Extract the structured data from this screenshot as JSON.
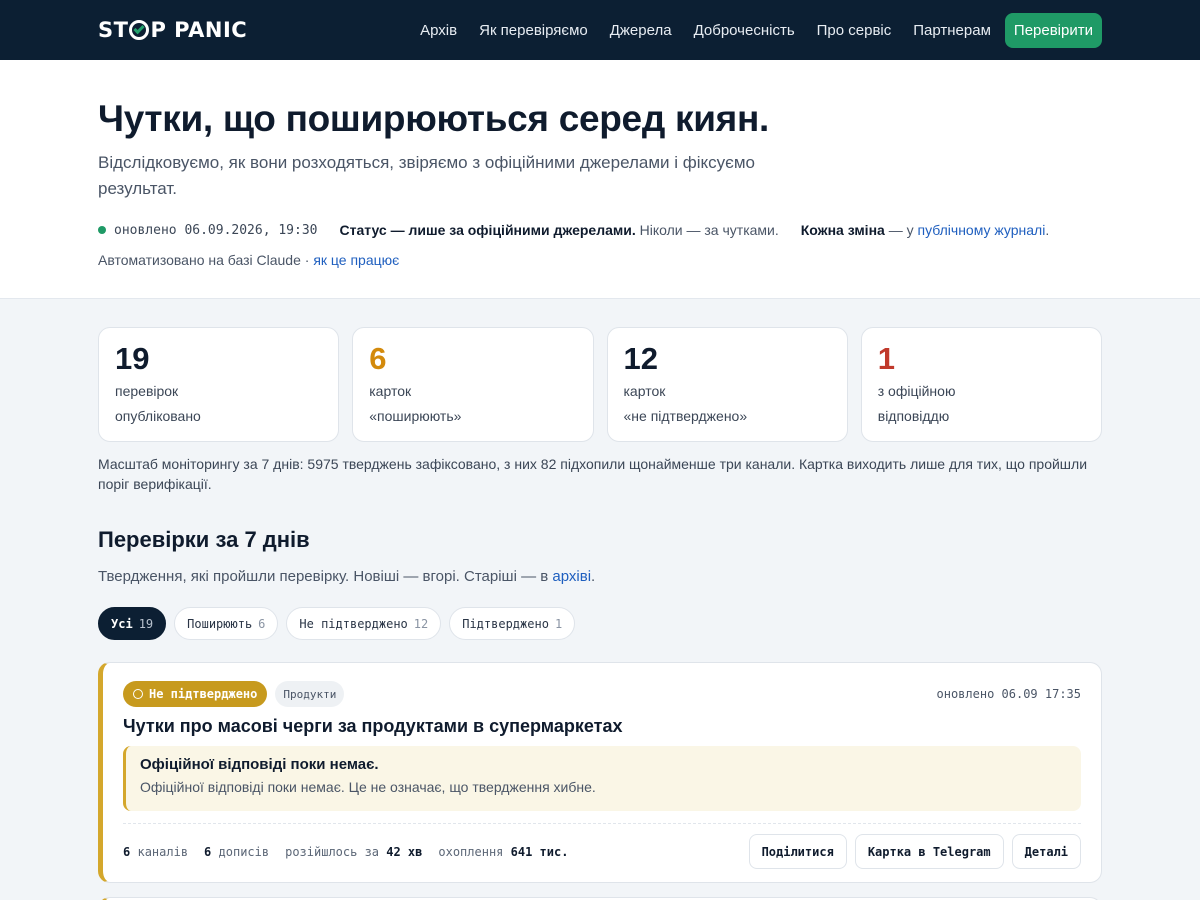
{
  "nav": {
    "logo_pre": "ST",
    "logo_post": "P PANIC",
    "links": [
      "Архів",
      "Як перевіряємо",
      "Джерела",
      "Доброчесність",
      "Про сервіс",
      "Партнерам"
    ],
    "cta": "Перевірити"
  },
  "hero": {
    "title": "Чутки, що поширюються серед киян.",
    "subtitle": "Відслідковуємо, як вони розходяться, звіряємо з офіційними джерелами і фіксуємо результат.",
    "updated": "оновлено 06.09.2026, 19:30",
    "status_bold": "Статус — лише за офіційними джерелами.",
    "status_rest": " Ніколи — за чутками.",
    "journal_bold": "Кожна зміна",
    "journal_mid": " — у ",
    "journal_link": "публічному журналі",
    "journal_end": ".",
    "auto_text": "Автоматизовано на базі Claude · ",
    "auto_link": "як це працює"
  },
  "stats": [
    {
      "num": "19",
      "l1": "перевірок",
      "l2": "опубліковано",
      "color": "#0f1b2d"
    },
    {
      "num": "6",
      "l1": "карток",
      "l2": "«поширюють»",
      "color": "#d38a0c"
    },
    {
      "num": "12",
      "l1": "карток",
      "l2": "«не підтверджено»",
      "color": "#0f1b2d"
    },
    {
      "num": "1",
      "l1": "з офіційною",
      "l2": "відповіддю",
      "color": "#c0392b"
    }
  ],
  "scale_text": "Масштаб моніторингу за 7 днів: 5975 тверджень зафіксовано, з них 82 підхопили щонайменше три канали. Картка виходить лише для тих, що пройшли поріг верифікації.",
  "section": {
    "title": "Перевірки за 7 днів",
    "sub_text": "Твердження, які пройшли перевірку. Новіші — вгорі. Старіші — в ",
    "sub_link": "архіві",
    "sub_end": "."
  },
  "filters": [
    {
      "label": "Усі",
      "count": "19",
      "active": true
    },
    {
      "label": "Поширюють",
      "count": "6",
      "active": false
    },
    {
      "label": "Не підтверджено",
      "count": "12",
      "active": false
    },
    {
      "label": "Підтверджено",
      "count": "1",
      "active": false
    }
  ],
  "card": {
    "badge": "Не підтверджено",
    "tag": "Продукти",
    "updated": "оновлено 06.09 17:35",
    "title": "Чутки про масові черги за продуктами в супермаркетах",
    "note_title": "Офіційної відповіді поки немає.",
    "note_body": "Офіційної відповіді поки немає. Це не означає, що твердження хибне.",
    "m1_val": "6",
    "m1_label": "каналів",
    "m2_val": "6",
    "m2_label": "дописів",
    "m3_label": "розійшлось за",
    "m3_val": "42 хв",
    "m4_label": "охоплення",
    "m4_val": "641 тис.",
    "btn_share": "Поділитися",
    "btn_tg": "Картка в Telegram",
    "btn_details": "Деталі"
  },
  "colors": {
    "accent": "#1f9a66",
    "warning": "#d4a72c",
    "navy": "#0c1f33"
  }
}
